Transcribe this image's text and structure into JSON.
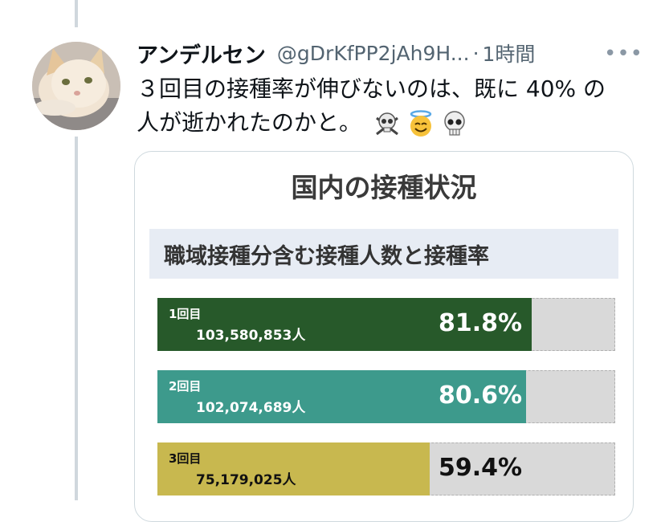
{
  "tweet": {
    "display_name": "アンデルセン",
    "handle": "@gDrKfPP2jAh9H...",
    "separator": "·",
    "time": "1時間",
    "more_label": "•••",
    "text_line1": "３回目の接種率が伸びないのは、既に 40% の",
    "text_line2": "人が逝かれたのかと。",
    "emojis": [
      "skull-and-crossbones",
      "smiling-face-with-halo",
      "skull"
    ]
  },
  "card": {
    "title": "国内の接種状況",
    "subtitle": "職域接種分含む接種人数と接種率",
    "bars": [
      {
        "label": "1回目",
        "count": "103,580,853人",
        "percent_text": "81.8%",
        "percent": 81.8,
        "color": "#27592a",
        "text_style": "light"
      },
      {
        "label": "2回目",
        "count": "102,074,689人",
        "percent_text": "80.6%",
        "percent": 80.6,
        "color": "#3d9a8c",
        "text_style": "light"
      },
      {
        "label": "3回目",
        "count": "75,179,025人",
        "percent_text": "59.4%",
        "percent": 59.4,
        "color": "#c8b84f",
        "text_style": "dark"
      }
    ]
  }
}
